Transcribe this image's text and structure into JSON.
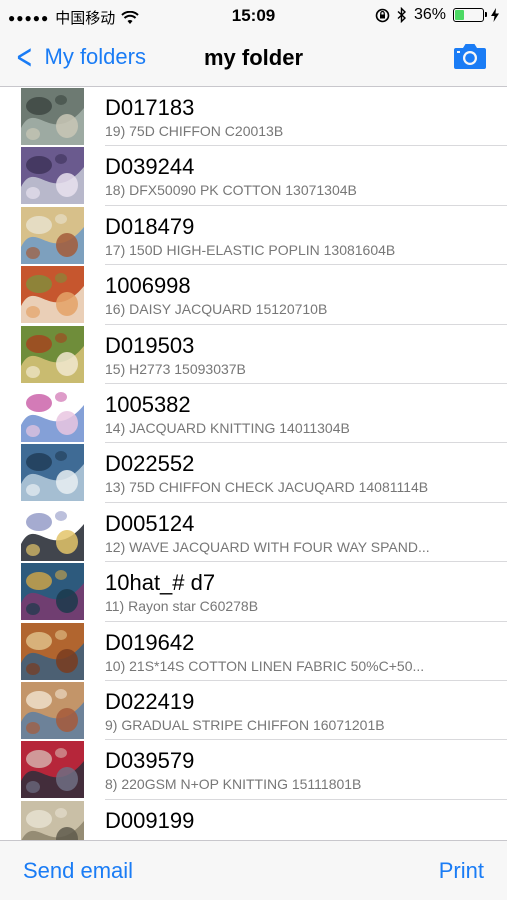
{
  "status": {
    "signal": "●●●●●",
    "carrier": "中国移动",
    "time": "15:09",
    "battery": "36%",
    "battery_level": 0.36,
    "colors": {
      "battery_fill": "#4cd964"
    }
  },
  "nav": {
    "back_label": "My folders",
    "title": "my folder",
    "camera_icon": "camera-icon",
    "accent": "#1a7cf5"
  },
  "items": [
    {
      "code": "D017183",
      "desc": "19) 75D CHIFFON C20013B",
      "colors": [
        "#6d7a72",
        "#a6b3aa",
        "#3b4540",
        "#c9c7b6"
      ]
    },
    {
      "code": "D039244",
      "desc": "18) DFX50090 PK COTTON 13071304B",
      "colors": [
        "#6a5a8e",
        "#c5c9d6",
        "#3c3158",
        "#e7e1ee"
      ]
    },
    {
      "code": "D018479",
      "desc": "17) 150D HIGH-ELASTIC POPLIN 13081604B",
      "colors": [
        "#d7c08a",
        "#6d9ac7",
        "#e9e2d0",
        "#a35c3a"
      ]
    },
    {
      "code": "1006998",
      "desc": "16) DAISY JACQUARD 15120710B",
      "colors": [
        "#c6562e",
        "#f0e4cf",
        "#7f8f3c",
        "#e4a267"
      ]
    },
    {
      "code": "D019503",
      "desc": "15) H2773  15093037B",
      "colors": [
        "#6f8d3a",
        "#d9c37a",
        "#a6421e",
        "#f1e8cf"
      ]
    },
    {
      "code": "1005382",
      "desc": "14) JACQUARD KNITTING  14011304B",
      "colors": [
        "#ffffff",
        "#6f8fd0",
        "#c85aa5",
        "#e9c6e0"
      ]
    },
    {
      "code": "D022552",
      "desc": "13) 75D CHIFFON CHECK JACUQARD 14081114B",
      "colors": [
        "#3f6b95",
        "#b7ccdd",
        "#1f3b55",
        "#e8eef2"
      ]
    },
    {
      "code": "D005124",
      "desc": "12) WAVE JACQUARD WITH FOUR WAY SPAND...",
      "colors": [
        "#ffffff",
        "#20242e",
        "#8f96c4",
        "#e3c46a"
      ]
    },
    {
      "code": "10hat_# d7",
      "desc": "11) Rayon star   C60278B",
      "colors": [
        "#2d5a7d",
        "#7c3a6e",
        "#d2a646",
        "#1b3a4b"
      ]
    },
    {
      "code": "D019642",
      "desc": "10) 21S*14S COTTON LINEN FABRIC 50%C+50...",
      "colors": [
        "#b1652f",
        "#3b5f7f",
        "#e2c48d",
        "#7a3c1f"
      ]
    },
    {
      "code": "D022419",
      "desc": "9) GRADUAL STRIPE CHIFFON 16071201B",
      "colors": [
        "#c39569",
        "#5e7fa2",
        "#f1e4d0",
        "#a65b3b"
      ]
    },
    {
      "code": "D039579",
      "desc": "8) 220GSM N+OP KNITTING 15111801B",
      "colors": [
        "#b6263a",
        "#2f2f3c",
        "#d7b7b1",
        "#6e6f84"
      ]
    },
    {
      "code": "D009199",
      "desc": "",
      "colors": [
        "#c9bfa6",
        "#8c826b",
        "#e9e3d3",
        "#5f5a4c"
      ]
    }
  ],
  "toolbar": {
    "send_email": "Send email",
    "print": "Print"
  }
}
